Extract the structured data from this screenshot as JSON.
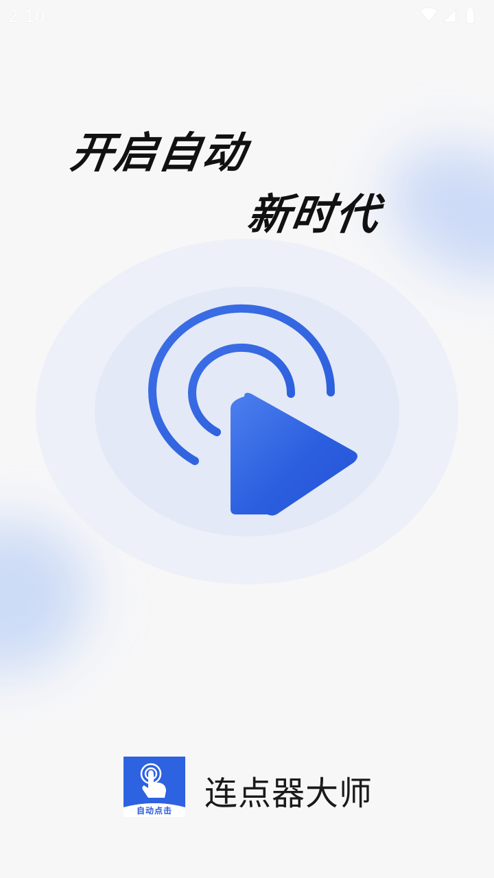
{
  "status_bar": {
    "time": "2:10",
    "icons": [
      "wifi-icon",
      "cellular-signal-icon",
      "battery-icon"
    ]
  },
  "headline": {
    "line1": "开启自动",
    "line2": "新时代"
  },
  "hero": {
    "icon": "cursor-click-icon",
    "accent_color": "#2d62e0",
    "ring_colors": [
      "#edf0f8",
      "#e3e9f6"
    ]
  },
  "brand": {
    "logo_icon": "tap-hand-icon",
    "logo_text": "自动点击",
    "app_name": "连点器大师",
    "logo_color": "#2d62e0"
  }
}
